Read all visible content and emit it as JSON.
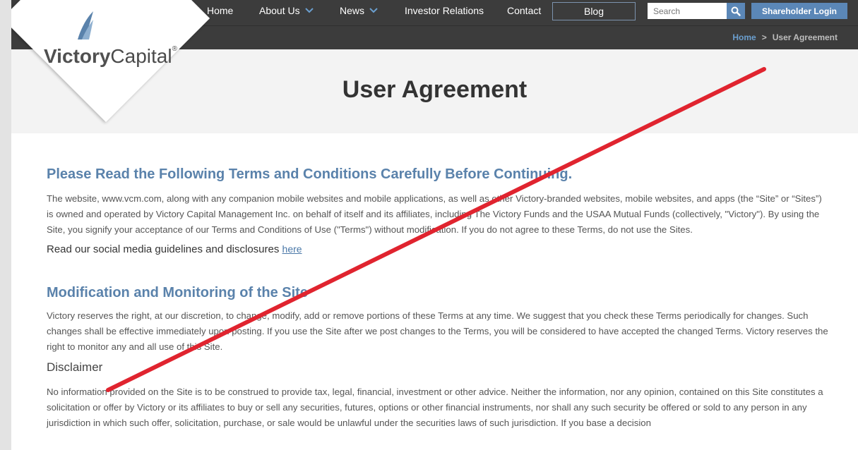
{
  "logo": {
    "brand_bold": "Victory",
    "brand_light": "Capital",
    "reg": "®"
  },
  "nav": {
    "home": "Home",
    "about": "About Us",
    "news": "News",
    "investor": "Investor Relations",
    "contact": "Contact",
    "blog": "Blog",
    "search_placeholder": "Search",
    "login": "Shareholder Login"
  },
  "breadcrumb": {
    "home": "Home",
    "sep": ">",
    "current": "User Agreement"
  },
  "page": {
    "title": "User Agreement"
  },
  "sections": {
    "terms_heading": "Please Read the Following Terms and Conditions Carefully Before Continuing.",
    "terms_body": "The website, www.vcm.com, along with any companion mobile websites and mobile applications, as well as other Victory-branded websites, mobile websites, and apps (the “Site” or “Sites”) is owned and operated by Victory Capital Management Inc. on behalf of itself and its affiliates, including The Victory Funds and the USAA Mutual Funds (collectively, \"Victory\"). By using the Site, you signify your acceptance of our Terms and Conditions of Use (\"Terms\") without modification. If you do not agree to these Terms, do not use the Sites.",
    "social_text": "Read our social media guidelines and disclosures",
    "social_link": "here",
    "mod_heading": "Modification and Monitoring of the Site",
    "mod_body": "Victory reserves the right, at our discretion, to change, modify, add or remove portions of these Terms at any time. We suggest that you check these Terms periodically for changes. Such changes shall be effective immediately upon posting. If you use the Site after we post changes to the Terms, you will be considered to have accepted the changed Terms. Victory reserves the right to monitor any and all use of this Site.",
    "disclaimer_heading": "Disclaimer",
    "disclaimer_body": "No information provided on the Site is to be construed to provide tax, legal, financial, investment or other advice. Neither the information, nor any opinion, contained on this Site constitutes a solicitation or offer by Victory or its affiliates to buy or sell any securities, futures, options or other financial instruments, nor shall any such security be offered or sold to any person in any jurisdiction in which such offer, solicitation, purchase, or sale would be unlawful under the securities laws of such jurisdiction. If you base a decision"
  },
  "colors": {
    "nav_bg": "#3c3c3c",
    "accent": "#5b87b7",
    "heading": "#5a82ab",
    "slash": "#e0242f"
  }
}
